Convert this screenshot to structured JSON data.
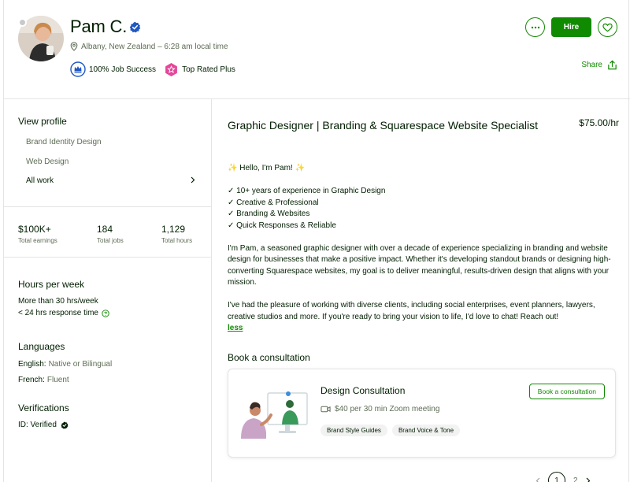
{
  "profile": {
    "name": "Pam C.",
    "location": "Albany, New Zealand – 6:28 am local time",
    "job_success": "100% Job Success",
    "top_rated": "Top Rated Plus"
  },
  "actions": {
    "hire_label": "Hire",
    "share_label": "Share"
  },
  "sidebar": {
    "view_profile": "View profile",
    "profile_links": [
      "Brand Identity Design",
      "Web Design"
    ],
    "all_work": "All work"
  },
  "stats": [
    {
      "value": "$100K+",
      "label": "Total earnings"
    },
    {
      "value": "184",
      "label": "Total jobs"
    },
    {
      "value": "1,129",
      "label": "Total hours"
    }
  ],
  "hours": {
    "title": "Hours per week",
    "availability": "More than 30 hrs/week",
    "response": "< 24 hrs response time"
  },
  "languages": {
    "title": "Languages",
    "items": [
      {
        "name": "English:",
        "level": "Native or Bilingual"
      },
      {
        "name": "French:",
        "level": "Fluent"
      }
    ]
  },
  "verifications": {
    "title": "Verifications",
    "id": "ID: Verified"
  },
  "main": {
    "title": "Graphic Designer | Branding & Squarespace Website Specialist",
    "rate": "$75.00/hr",
    "greeting": "✨ Hello, I'm Pam! ✨",
    "bullets": [
      "✓ 10+ years of experience in Graphic Design",
      "✓ Creative & Professional",
      "✓ Branding & Websites",
      "✓ Quick Responses & Reliable"
    ],
    "para1": "I'm Pam, a seasoned graphic designer with over a decade of experience specializing in branding and website design for businesses that make a positive impact. Whether it's developing standout brands or designing high-converting Squarespace websites, my goal is to deliver meaningful, results-driven design that aligns with your mission.",
    "para2": "I've had the pleasure of working with diverse clients, including social enterprises, event planners, lawyers, creative studios and more. If you're ready to bring your vision to life, I'd love to chat! Reach out!",
    "less_label": "less"
  },
  "consultation": {
    "section_title": "Book a consultation",
    "card_title": "Design Consultation",
    "price": "$40 per 30 min Zoom meeting",
    "tags": [
      "Brand Style Guides",
      "Brand Voice & Tone"
    ],
    "button_label": "Book a consultation"
  },
  "pager": {
    "current": "1",
    "next": "2"
  },
  "colors": {
    "brand_green": "#108a00",
    "text_dark": "#001e00",
    "text_muted": "#5e6d55",
    "verified_blue": "#1f57c3",
    "top_rated_pink": "#e4479a"
  }
}
